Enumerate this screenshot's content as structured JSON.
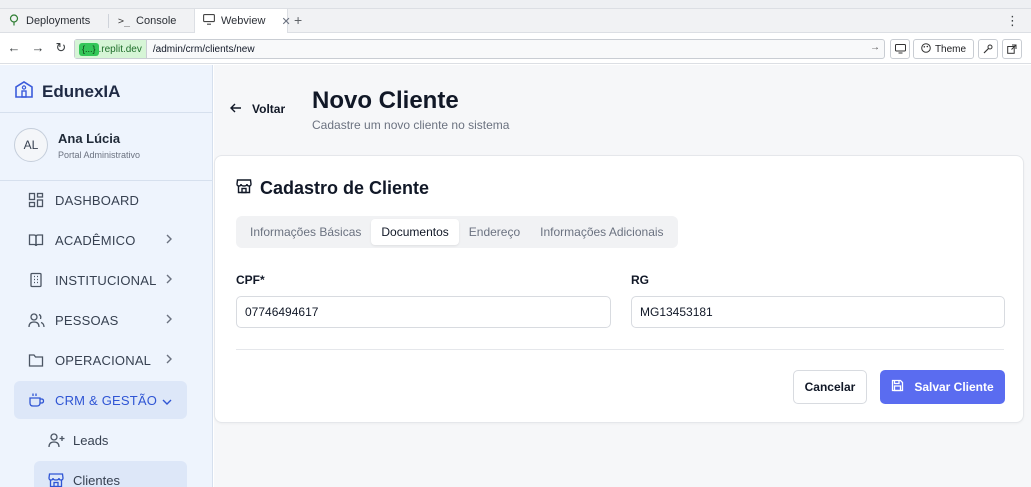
{
  "browser": {
    "tabs": [
      {
        "label": "Deployments",
        "icon": "tree-icon"
      },
      {
        "label": "Console",
        "icon": "terminal-icon"
      },
      {
        "label": "Webview",
        "icon": "monitor-icon"
      }
    ],
    "url_host": ".replit.dev",
    "url_chip": "{...}",
    "url_path": "/admin/crm/clients/new",
    "theme_label": "Theme"
  },
  "sidebar": {
    "brand": "EdunexIA",
    "user": {
      "initials": "AL",
      "name": "Ana Lúcia",
      "role": "Portal Administrativo"
    },
    "items": [
      {
        "label": "DASHBOARD",
        "icon": "dashboard-icon"
      },
      {
        "label": "ACADÊMICO",
        "icon": "book-icon"
      },
      {
        "label": "INSTITUCIONAL",
        "icon": "building-icon"
      },
      {
        "label": "PESSOAS",
        "icon": "people-icon"
      },
      {
        "label": "OPERACIONAL",
        "icon": "folder-icon"
      },
      {
        "label": "CRM & GESTÃO",
        "icon": "coffee-icon"
      }
    ],
    "subitems": [
      {
        "label": "Leads",
        "icon": "user-plus-icon"
      },
      {
        "label": "Clientes",
        "icon": "store-icon"
      }
    ]
  },
  "main": {
    "back_label": "Voltar",
    "title": "Novo Cliente",
    "subtitle": "Cadastre um novo cliente no sistema",
    "card_title": "Cadastro de Cliente",
    "tabs": [
      "Informações Básicas",
      "Documentos",
      "Endereço",
      "Informações Adicionais"
    ],
    "selected_tab": "Documentos",
    "fields": {
      "cpf_label": "CPF*",
      "cpf_value": "07746494617",
      "rg_label": "RG",
      "rg_value": "MG13453181"
    },
    "cancel_label": "Cancelar",
    "save_label": "Salvar Cliente"
  },
  "colors": {
    "accent": "#5a6cf0",
    "sidebar_bg": "#eef4fd",
    "active_nav": "#2f55d4"
  }
}
